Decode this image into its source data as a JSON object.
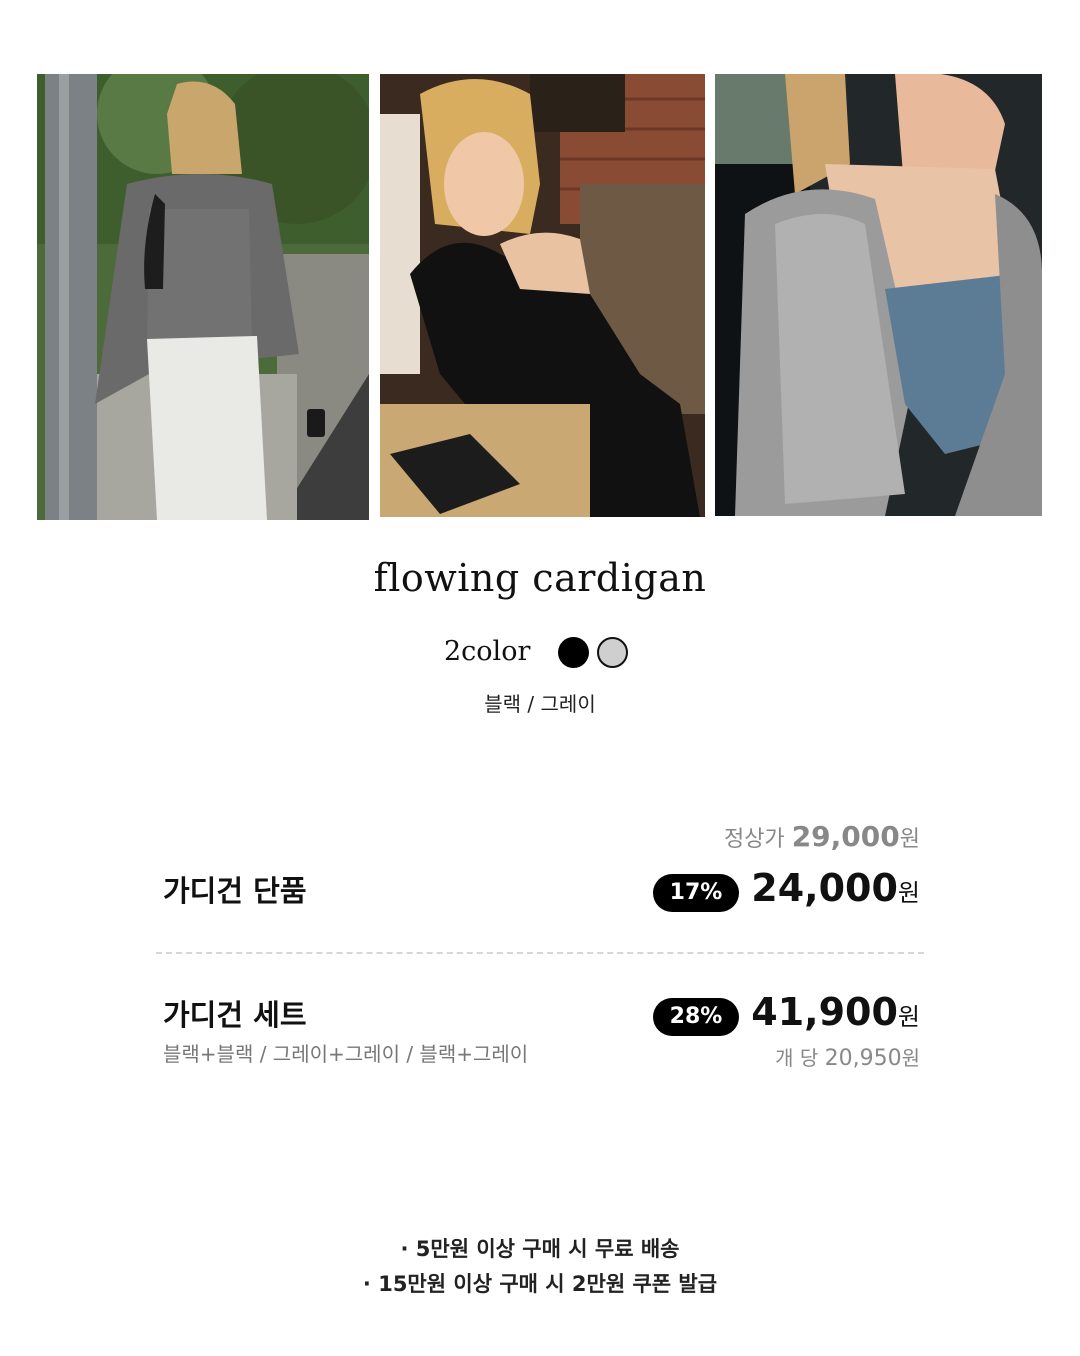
{
  "product": {
    "title": "flowing cardigan",
    "color_count": "2color",
    "swatches": [
      {
        "name": "black",
        "color": "#000000"
      },
      {
        "name": "gray",
        "color": "#cfcfcf"
      }
    ],
    "color_names": "블랙 / 그레이"
  },
  "pricing": {
    "regular_label": "정상가",
    "regular_price": "29,000",
    "currency": "원",
    "single": {
      "name": "가디건 단품",
      "discount": "17%",
      "price": "24,000"
    },
    "set": {
      "name": "가디건 세트",
      "options": "블랙+블랙 / 그레이+그레이 / 블랙+그레이",
      "discount": "28%",
      "price": "41,900",
      "per_piece_label": "개 당",
      "per_piece_price": "20,950"
    }
  },
  "notes": [
    "· 5만원 이상 구매 시 무료 배송",
    "· 15만원 이상 구매 시 2만원 쿠폰 발급"
  ]
}
